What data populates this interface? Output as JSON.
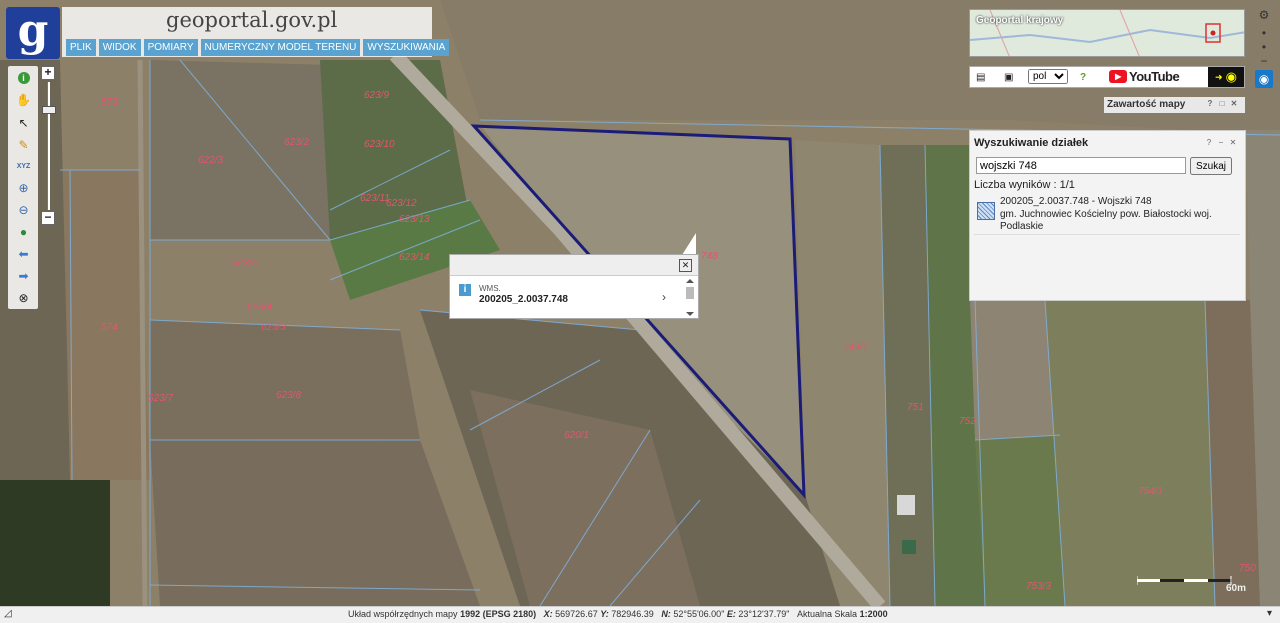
{
  "site": {
    "title": "geoportal.gov.pl",
    "logo_letter": "g"
  },
  "menu": [
    "PLIK",
    "WIDOK",
    "POMIARY",
    "NUMERYCZNY MODEL TERENU",
    "WYSZUKIWANIA"
  ],
  "overview": {
    "label": "Geoportal krajowy"
  },
  "tools": {
    "language": "pol",
    "youtube": "YouTube"
  },
  "content_panel": {
    "title": "Zawartość mapy"
  },
  "search": {
    "title": "Wyszukiwanie działek",
    "input_value": "wojszki 748",
    "button": "Szukaj",
    "count": "Liczba wyników : 1/1",
    "result_line1": "200205_2.0037.748 - Wojszki 748",
    "result_line2": "gm. Juchnowiec Kościelny pow. Białostocki woj. Podlaskie"
  },
  "popup": {
    "source": "WMS.",
    "id": "200205_2.0037.748"
  },
  "parcels": [
    "573",
    "623/9",
    "623/2",
    "623/10",
    "622/3",
    "623/11",
    "623/12",
    "623/13",
    "623/14",
    "623/5",
    "623/4",
    "623/3",
    "748",
    "749/1",
    "574",
    "623/8",
    "623/7",
    "620/1",
    "751",
    "752",
    "754/1",
    "753/3",
    "750"
  ],
  "scale": {
    "label": "60m"
  },
  "status": {
    "prefix": "Układ współrzędnych mapy",
    "crs": "1992 (EPSG 2180)",
    "x_label": "X:",
    "x": "569726.67",
    "y_label": "Y:",
    "y": "782946.39",
    "n_label": "N:",
    "n": "52°55'06.00\"",
    "e_label": "E:",
    "e": "23°12'37.79\"",
    "scale_label": "Aktualna Skala",
    "scale": "1:2000"
  }
}
